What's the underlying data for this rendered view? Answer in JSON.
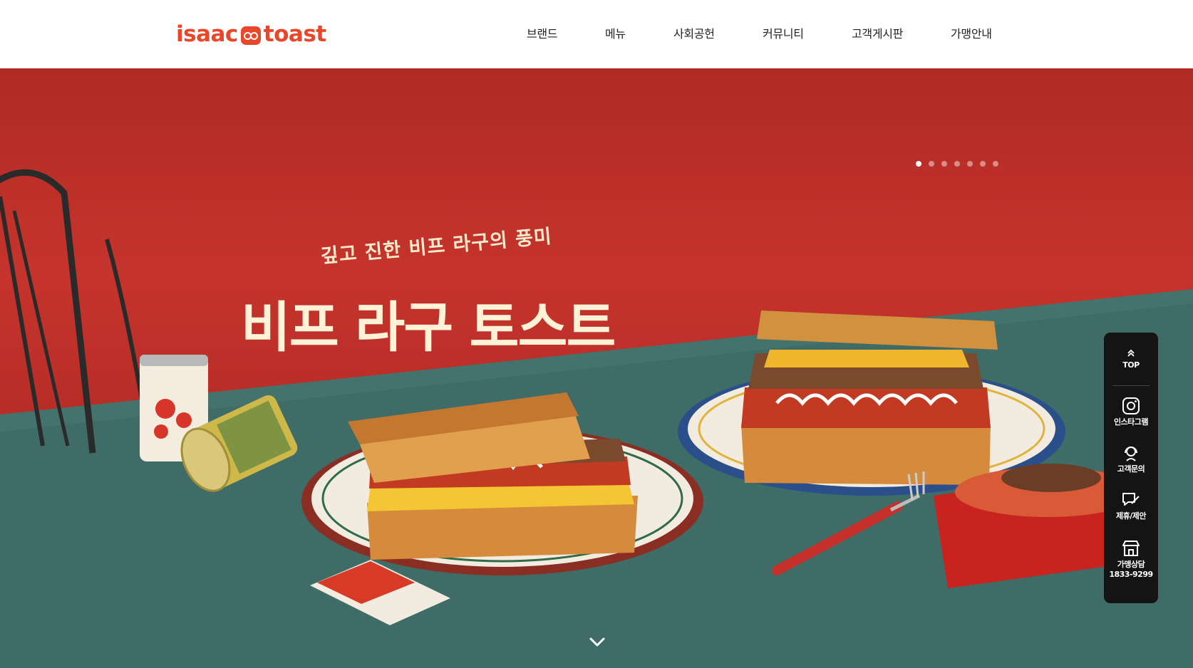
{
  "brand": {
    "logo_left": "isaac",
    "logo_right": "toast"
  },
  "nav": {
    "items": [
      "브랜드",
      "메뉴",
      "사회공헌",
      "커뮤니티",
      "고객게시판",
      "가맹안내"
    ]
  },
  "hero": {
    "subtitle": "깊고 진한 비프 라구의 풍미",
    "title": "비프 라구 토스트",
    "slide_count": 7,
    "active_slide": 1
  },
  "quick_menu": {
    "top_label": "TOP",
    "instagram_label": "인스타그램",
    "inquiry_label": "고객문의",
    "partner_label": "제휴/제안",
    "franchise_label": "가맹상담",
    "franchise_phone": "1833-9299"
  },
  "colors": {
    "brand": "#e9462a",
    "wall": "#c5342c",
    "table": "#3f6c67",
    "title": "#fff2d6"
  }
}
